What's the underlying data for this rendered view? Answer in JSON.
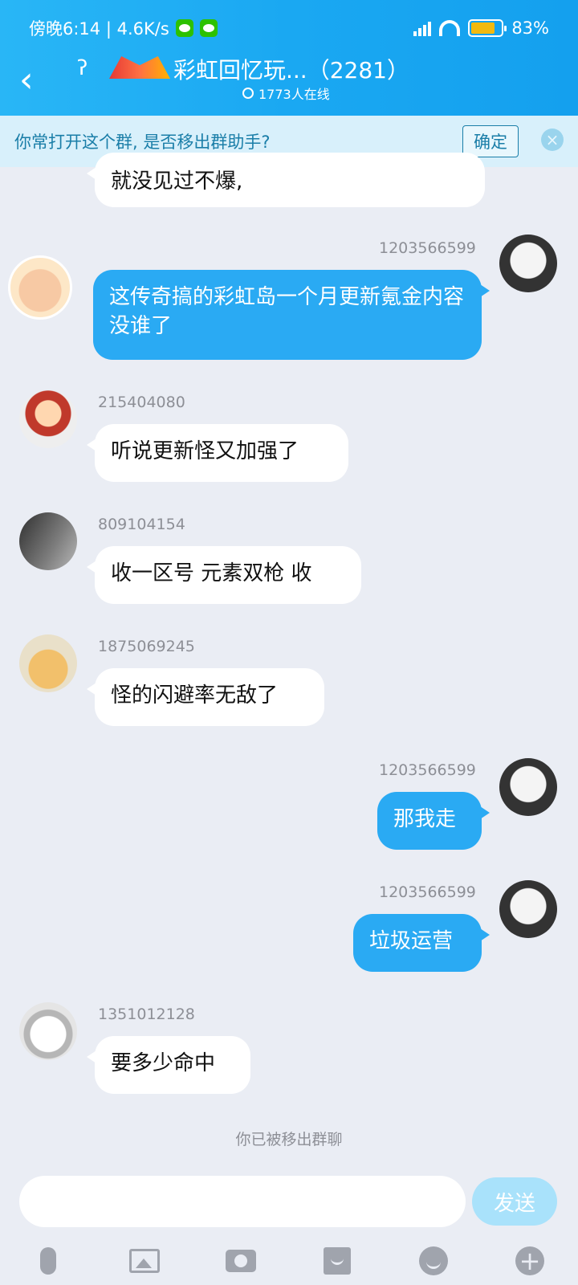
{
  "status_bar": {
    "time_net": "傍晚6:14 | 4.6K/s",
    "battery": "83%"
  },
  "header": {
    "back_label": "‹",
    "title": "彩虹回忆玩...（2281）",
    "online": "1773人在线"
  },
  "banner": {
    "text": "你常打开这个群, 是否移出群助手?",
    "confirm": "确定",
    "close": "×"
  },
  "messages": [
    {
      "uid": "",
      "text": "就没见过不爆,"
    },
    {
      "uid": "1203566599",
      "text": "这传奇搞的彩虹岛一个月更新氪金内容没谁了"
    },
    {
      "uid": "215404080",
      "text": "听说更新怪又加强了"
    },
    {
      "uid": "809104154",
      "text": "收一区号 元素双枪 收"
    },
    {
      "uid": "1875069245",
      "text": "怪的闪避率无敌了"
    },
    {
      "uid": "1203566599",
      "text": "那我走"
    },
    {
      "uid": "1203566599",
      "text": "垃圾运营"
    },
    {
      "uid": "1351012128",
      "text": "要多少命中"
    }
  ],
  "notice": "你已被移出群聊",
  "input": {
    "placeholder": "",
    "send": "发送"
  },
  "toolbar": [
    "mic-icon",
    "image-icon",
    "camera-icon",
    "red-packet-icon",
    "emoji-icon",
    "plus-icon"
  ]
}
